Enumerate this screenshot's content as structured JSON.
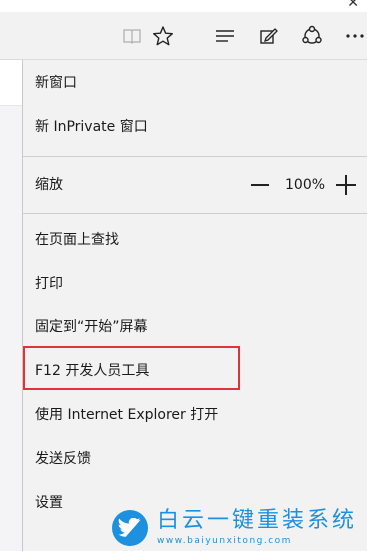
{
  "toolbar": {
    "reading_view_icon": "book-icon",
    "favorite_icon": "star-icon",
    "hub_icon": "hub-icon",
    "note_icon": "web-note-icon",
    "share_icon": "share-icon",
    "more_icon": "more-icon"
  },
  "menu": {
    "new_window": "新窗口",
    "new_inprivate": "新 InPrivate 窗口",
    "zoom_label": "缩放",
    "zoom_value": "100%",
    "find_on_page": "在页面上查找",
    "print": "打印",
    "pin_to_start": "固定到“开始”屏幕",
    "f12_dev_tools": "F12 开发人员工具",
    "open_with_ie": "使用 Internet Explorer 打开",
    "send_feedback": "发送反馈",
    "settings": "设置"
  },
  "watermark": {
    "title": "白云一键重装系统",
    "url": "www.baiyunxitong.com"
  },
  "colors": {
    "highlight": "#e0323c",
    "brand": "#1e90e0"
  }
}
